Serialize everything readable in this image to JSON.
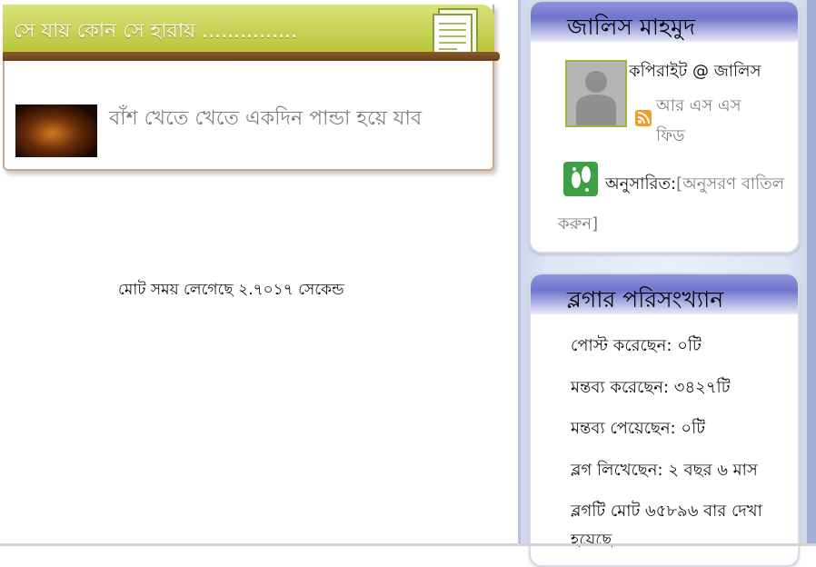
{
  "left": {
    "post_box_title": "সে যায় কোন সে হারায় ...............",
    "post_link": "বাঁশ খেতে খেতে একদিন পান্ডা হয়ে যাব",
    "time_note": "মোট সময় লেগেছে ২.৭০১৭ সেকেন্ড"
  },
  "profile": {
    "name": "জালিস মাহমুদ",
    "copyright": "কপিরাইট @ জালিস",
    "rss": "আর এস এস ফিড",
    "follow_label": "অনুসারিত:",
    "unfollow": "[অনুসরণ বাতিল করুন]"
  },
  "stats": {
    "title": "ব্লগার পরিসংখ্যান",
    "posts": "পোস্ট করেছেন: ০টি",
    "comments_made": "মন্তব্য করেছেন: ৩৪২৭টি",
    "comments_received": "মন্তব্য পেয়েছেন: ০টি",
    "blogging_since": "ব্লগ লিখেছেন:  ২ বছর ৬ মাস",
    "views_line1": "ব্লগটি মোট  ৬৫৮৯৬ বার দেখা",
    "views_line2": "হয়েছে"
  },
  "colors": {
    "header_green": "#c6d04a",
    "widget_purple": "#6e75cc",
    "link_gray": "#7c7c7c",
    "rss_orange": "#f59a23",
    "follow_green": "#3ea044"
  }
}
